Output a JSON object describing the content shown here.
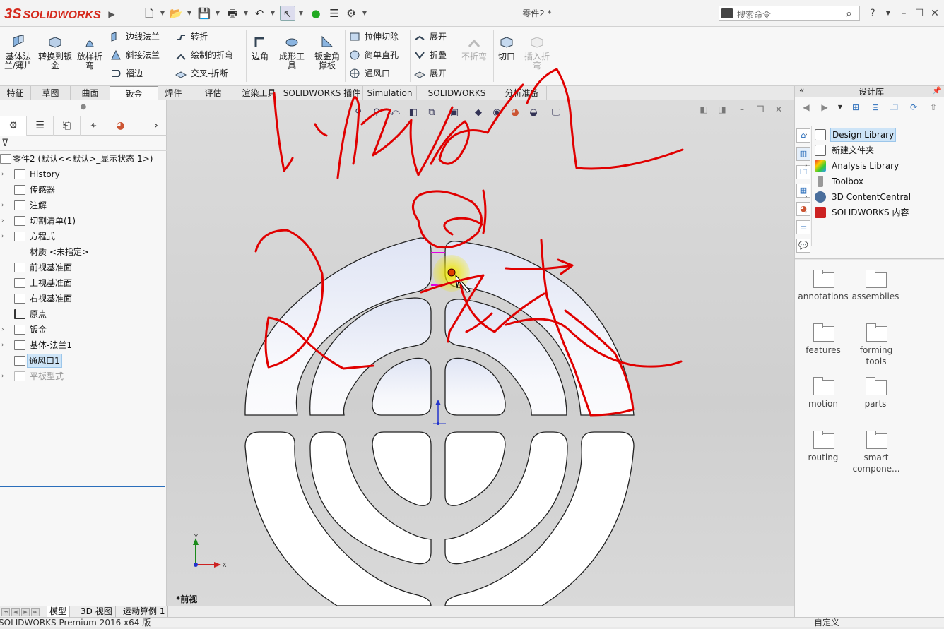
{
  "titlebar": {
    "brand": "SOLIDWORKS",
    "document_title": "零件2 *",
    "search_placeholder": "搜索命令",
    "help": "?"
  },
  "ribbon": {
    "big": [
      {
        "label": "基体法兰/薄片",
        "name": "base-flange-button"
      },
      {
        "label": "转换到钣金",
        "name": "convert-to-sheetmetal-button"
      },
      {
        "label": "放样折弯",
        "name": "lofted-bend-button"
      },
      {
        "label": "边角",
        "name": "corners-button"
      },
      {
        "label": "成形工具",
        "name": "forming-tool-button"
      },
      {
        "label": "钣金角撑板",
        "name": "sheetmetal-gusset-button"
      },
      {
        "label": "不折弯",
        "name": "no-bends-button"
      },
      {
        "label": "切口",
        "name": "rip-button"
      },
      {
        "label": "插入折弯",
        "name": "insert-bends-button"
      }
    ],
    "small": [
      {
        "label": "边线法兰",
        "name": "edge-flange-button"
      },
      {
        "label": "斜接法兰",
        "name": "miter-flange-button"
      },
      {
        "label": "褶边",
        "name": "hem-button"
      },
      {
        "label": "转折",
        "name": "jog-button"
      },
      {
        "label": "绘制的折弯",
        "name": "sketched-bend-button"
      },
      {
        "label": "交叉-折断",
        "name": "cross-break-button"
      },
      {
        "label": "拉伸切除",
        "name": "extruded-cut-button"
      },
      {
        "label": "简单直孔",
        "name": "simple-hole-button"
      },
      {
        "label": "通风口",
        "name": "vent-button"
      },
      {
        "label": "展开",
        "name": "unfold-button"
      },
      {
        "label": "折叠",
        "name": "fold-button"
      },
      {
        "label": "展开",
        "name": "flatten-button"
      }
    ]
  },
  "tabs": [
    "特征",
    "草图",
    "曲面",
    "钣金",
    "焊件",
    "评估",
    "渲染工具",
    "SOLIDWORKS 插件",
    "Simulation",
    "SOLIDWORKS MBD",
    "分析准备"
  ],
  "active_tab": "钣金",
  "feature_tree": {
    "root": "零件2 (默认<<默认>_显示状态 1>)",
    "items": [
      "History",
      "传感器",
      "注解",
      "切割清单(1)",
      "方程式",
      "材质 <未指定>",
      "前视基准面",
      "上视基准面",
      "右视基准面",
      "原点",
      "钣金",
      "基体-法兰1",
      "通风口1",
      "平板型式"
    ]
  },
  "viewport": {
    "view_name": "*前视",
    "axis_x": "X",
    "axis_y": "Y"
  },
  "bottom_tabs": [
    "模型",
    "3D 视图",
    "运动算例 1"
  ],
  "status_bar": {
    "text": "SOLIDWORKS Premium 2016 x64 版",
    "custom": "自定义"
  },
  "design_library": {
    "title": "设计库",
    "tree": [
      "Design Library",
      "新建文件夹",
      "Analysis Library",
      "Toolbox",
      "3D ContentCentral",
      "SOLIDWORKS 内容"
    ],
    "folders": [
      "annotations",
      "assemblies",
      "features",
      "forming tools",
      "motion",
      "parts",
      "routing",
      "smart compone..."
    ]
  },
  "colors": {
    "accent": "#2a6ebb",
    "brand": "#d52b1e",
    "ink": "#e00000",
    "selection": "#cde4f7"
  }
}
